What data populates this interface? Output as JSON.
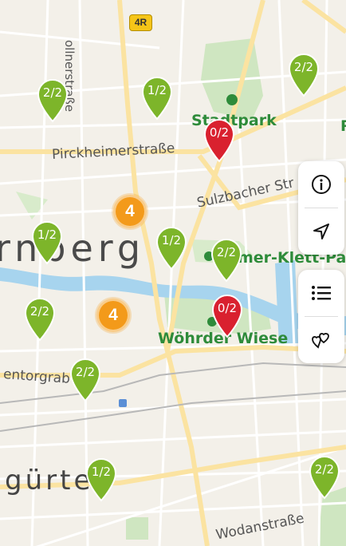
{
  "map": {
    "city_label": "rnberg",
    "street_labels": {
      "pirckheimer": "Pirckheimerstraße",
      "sulzbacher": "Sulzbacher Str",
      "rollner": "ollnerstraße",
      "wodan": "Wodanstraße",
      "gurtel": "gürtel",
      "gostenhofer": "entorgrab"
    },
    "park_labels": {
      "stadtpark": "Stadtpark",
      "wohrder": "Wöhrder Wiese",
      "klett": "mer-Klett-Par",
      "edge_p": "P"
    },
    "road_badge": "4R",
    "pins": [
      {
        "label": "2/2",
        "color": "#7db52a"
      },
      {
        "label": "1/2",
        "color": "#7db52a"
      },
      {
        "label": "2/2",
        "color": "#7db52a"
      },
      {
        "label": "0/2",
        "color": "#d9212f"
      },
      {
        "label": "1/2",
        "color": "#7db52a"
      },
      {
        "label": "1/2",
        "color": "#7db52a"
      },
      {
        "label": "2/2",
        "color": "#7db52a"
      },
      {
        "label": "2/2",
        "color": "#7db52a"
      },
      {
        "label": "0/2",
        "color": "#d9212f"
      },
      {
        "label": "2/2",
        "color": "#7db52a"
      },
      {
        "label": "1/2",
        "color": "#7db52a"
      },
      {
        "label": "2/2",
        "color": "#7db52a"
      }
    ],
    "clusters": [
      {
        "label": "4"
      },
      {
        "label": "4"
      }
    ]
  },
  "controls": {
    "info": "info-icon",
    "locate": "location-arrow-icon",
    "list": "list-icon",
    "favorites": "hearts-icon"
  }
}
